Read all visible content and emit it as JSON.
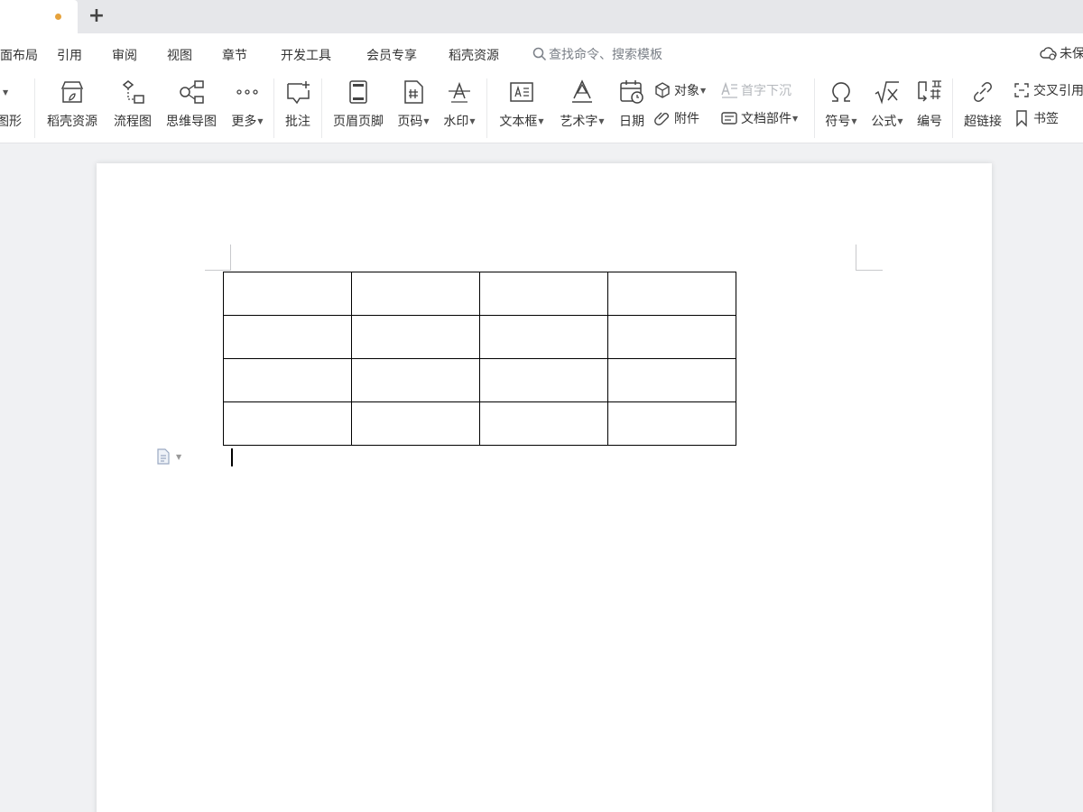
{
  "tabs": {
    "new_tab_label": "+"
  },
  "menu": {
    "items": [
      "页面布局",
      "引用",
      "审阅",
      "视图",
      "章节",
      "开发工具",
      "会员专享",
      "稻壳资源"
    ],
    "search_placeholder": "查找命令、搜索模板",
    "cloud_label": "未保存"
  },
  "ribbon": {
    "shapes_label": "图形",
    "docer_resources": "稻壳资源",
    "flowchart": "流程图",
    "mindmap": "思维导图",
    "more": "更多",
    "comment": "批注",
    "header_footer": "页眉页脚",
    "page_number": "页码",
    "watermark": "水印",
    "textbox": "文本框",
    "wordart": "艺术字",
    "date": "日期",
    "object": "对象",
    "attachment": "附件",
    "drop_cap": "首字下沉",
    "doc_parts": "文档部件",
    "symbol": "符号",
    "formula": "公式",
    "numbering": "编号",
    "hyperlink": "超链接",
    "cross_reference": "交叉引用",
    "bookmark": "书签"
  },
  "document": {
    "table": {
      "rows": 4,
      "cols": 4
    }
  },
  "colors": {
    "accent": "#e6a23c",
    "tabbar": "#e6e7ea",
    "canvas": "#f0f1f3"
  }
}
